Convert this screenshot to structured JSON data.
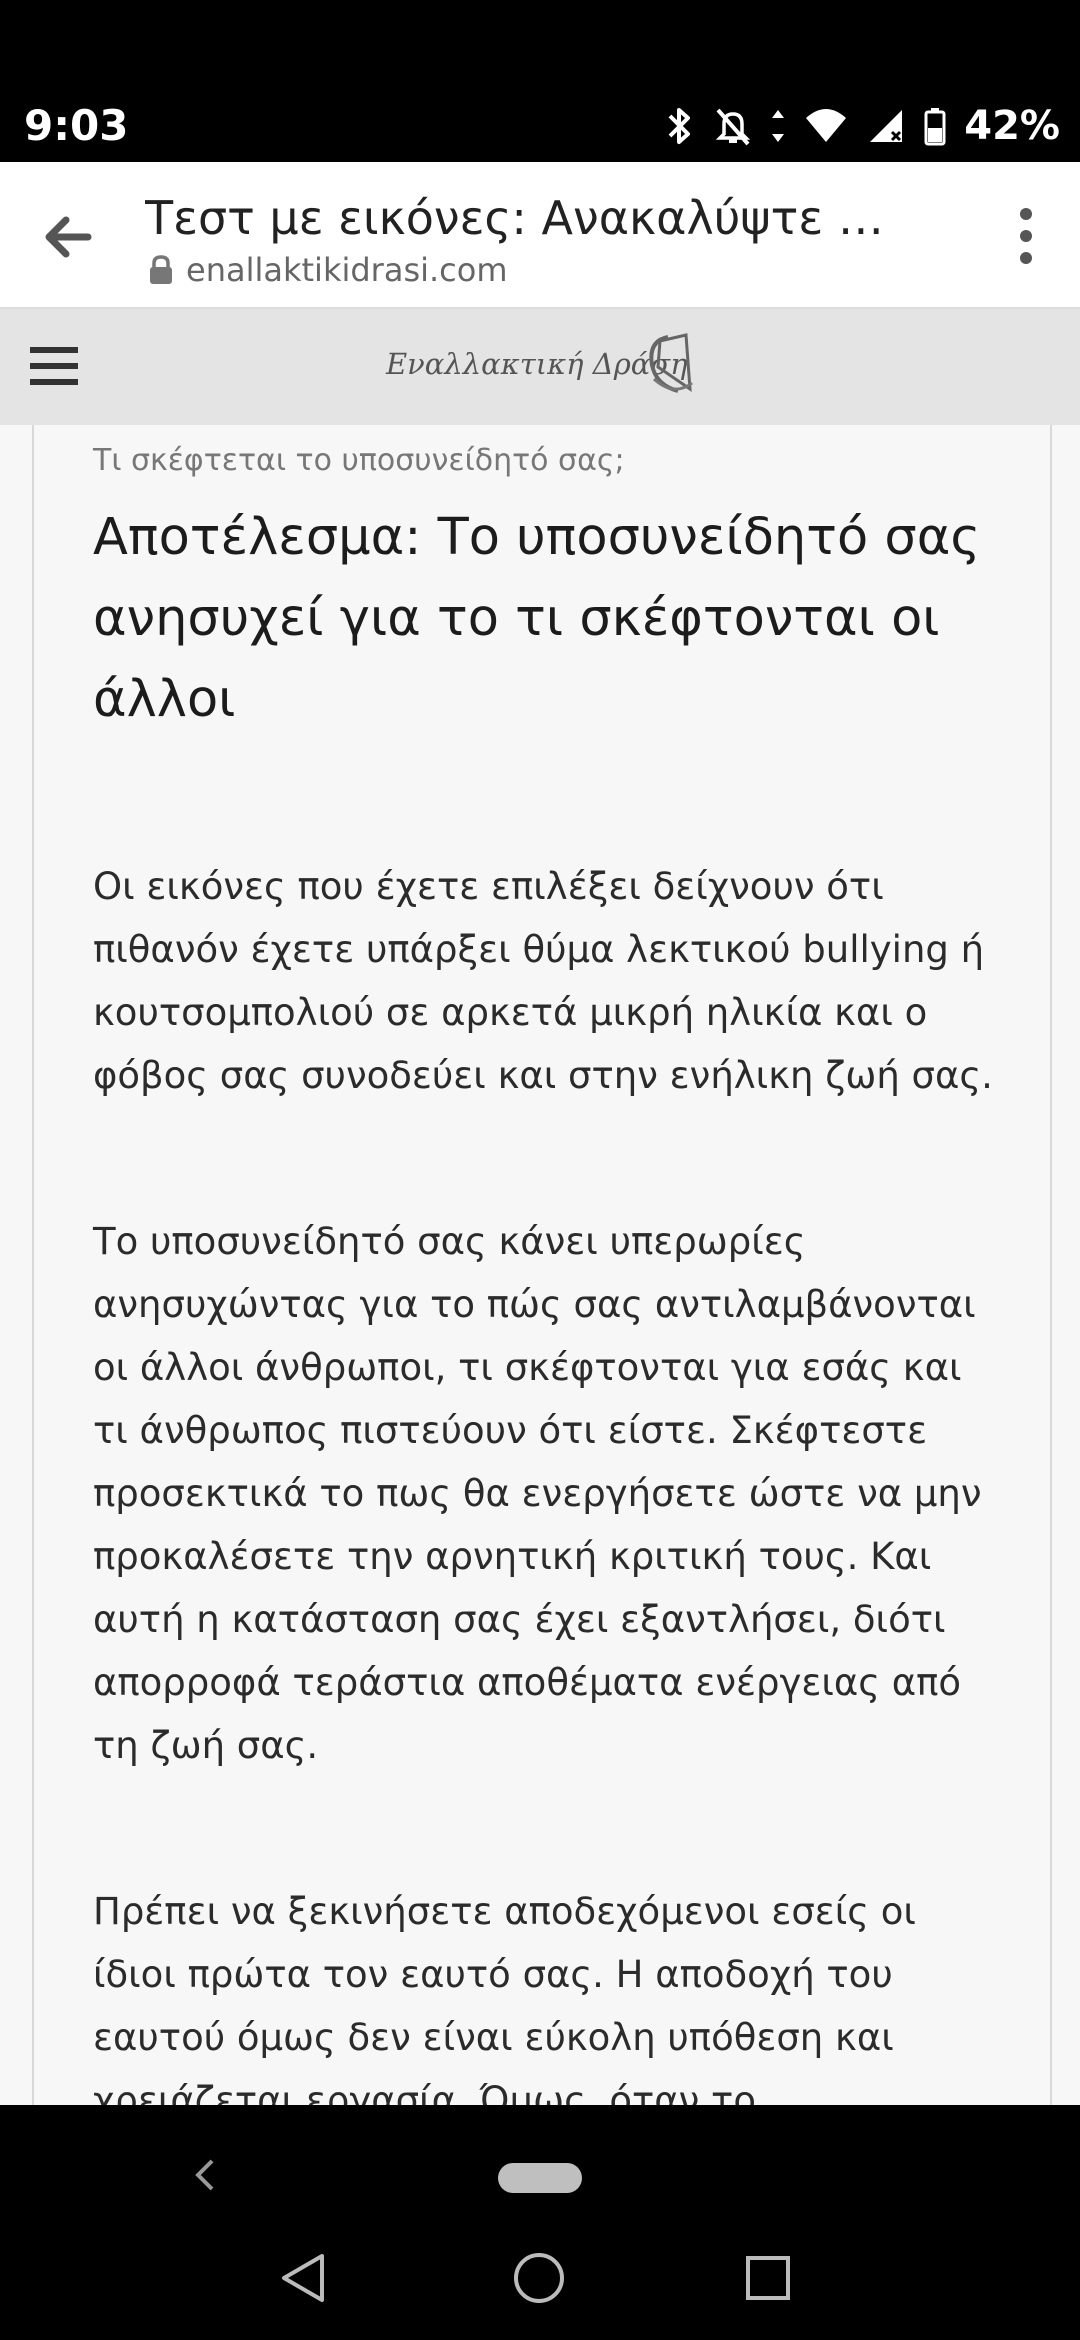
{
  "status": {
    "time": "9:03",
    "battery": "42%"
  },
  "browser": {
    "page_title": "Τεστ με εικόνες: Ανακαλύψτε τ...",
    "domain": "enallaktikidrasi.com"
  },
  "site": {
    "logo_text": "Εναλλακτική Δράση"
  },
  "article": {
    "subtitle": "Τι σκέφτεται το υποσυνείδητό σας;",
    "title": "Αποτέλεσμα: Το υποσυνείδητό σας ανησυχεί για το τι σκέφτονται οι άλλοι",
    "paragraphs": [
      "Οι εικόνες που έχετε επιλέξει δείχνουν ότι πιθανόν έχετε υπάρξει θύμα λεκτικού bullying ή κουτσομπολιού σε αρκετά μικρή ηλικία και ο φόβος σας συνοδεύει και στην ενήλικη ζωή σας.",
      "Το υποσυνείδητό σας κάνει υπερωρίες ανησυχώντας για το πώς σας αντιλαμβάνονται οι άλλοι άνθρωποι, τι σκέφτονται για εσάς και τι άνθρωπος πιστεύουν ότι είστε. Σκέφτεστε προσεκτικά το πως θα ενεργήσετε ώστε να μην προκαλέσετε την αρνητική κριτική τους. Και αυτή η κατάσταση σας έχει εξαντλήσει, διότι απορροφά τεράστια αποθέματα ενέργειας από τη ζωή σας.",
      "Πρέπει να ξεκινήσετε αποδεχόμενοι εσείς οι ίδιοι πρώτα τον εαυτό σας.  Η αποδοχή του εαυτού όμως δεν είναι εύκολη υπόθεση και χρειάζεται εργασία. Όμως, όταν το"
    ]
  }
}
